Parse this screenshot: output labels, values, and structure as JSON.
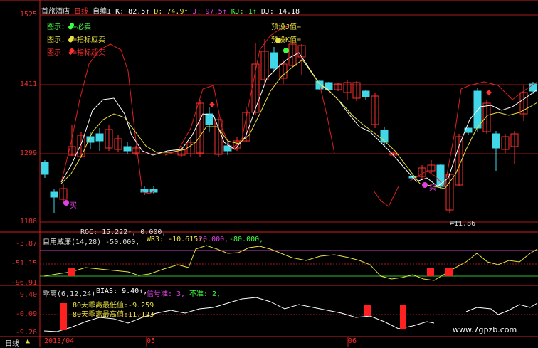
{
  "header": {
    "stock_name": "首旅酒店",
    "period": "日线",
    "indicator": "自编1",
    "k": "K: 82.5↑",
    "d": "D: 74.9↑",
    "j": "J: 97.5↑",
    "kj": "KJ: 1↑",
    "dj": "DJ: 14.18"
  },
  "legend": {
    "must_sell": "图示：●=必卖",
    "should_sell": "图示：●=指标应卖",
    "overbought": "图示：◆=指标超卖",
    "warn_j": "预设J值=",
    "warn_k": "预设K值="
  },
  "main_axis": {
    "labels": [
      "1525",
      "1411",
      "1299",
      "1186"
    ]
  },
  "annotations": {
    "buy1": "买",
    "buy2": "买",
    "low_value": "←11.86"
  },
  "wr_panel": {
    "roc": "ROC: 15.222↑, 0.000,",
    "title": "自用威廉(14,28) -50.000,",
    "wr3": "WR3: -10.615↑,",
    "line_a": "-20.000,",
    "line_b": "-80.000,",
    "axis": [
      "-3.87",
      "-51.15",
      "-96.91"
    ]
  },
  "bias_panel": {
    "title": "乖离(6,12,24)",
    "bias": "BIAS: 9.40↑,",
    "signal": "信号准: 3,",
    "not_accurate": "不准: 2,",
    "min_note": "80天乖离最低值:-9.259",
    "max_note": "80天乖离最高值:11.123",
    "axis": [
      "9.40",
      "-0.09",
      "-9.26"
    ]
  },
  "bottom_bar": {
    "period_tab": "日线",
    "dates": [
      "2013/04",
      "05",
      "06"
    ]
  },
  "watermark": "www.7gpzb.com",
  "chart_data": {
    "type": "candlestick",
    "title": "",
    "ylabel": "",
    "y_ticks": [
      "1525",
      "1411",
      "1299",
      "1186"
    ],
    "colors": {
      "up": "#ff3030",
      "down": "#40d8e8",
      "k_line": "#ffffff",
      "d_line": "#e8e040",
      "red_line": "#dd2020",
      "wr_line": "#e8e040",
      "bias_line": "#ffffff"
    }
  }
}
